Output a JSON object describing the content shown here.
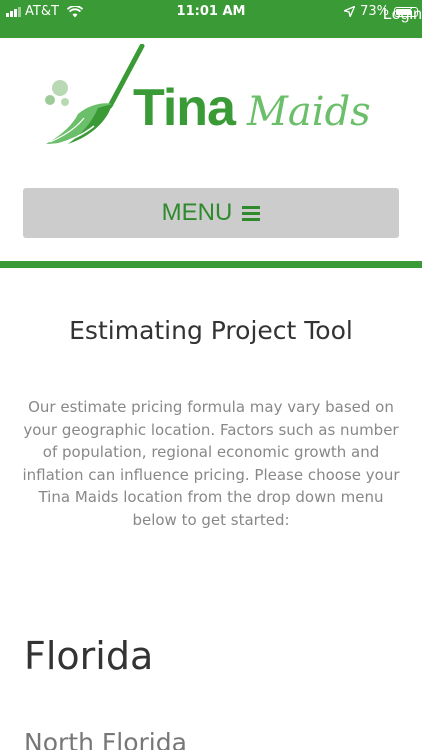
{
  "status_bar": {
    "carrier": "AT&T",
    "time": "11:01 AM",
    "battery": "73%",
    "battery_level": 0.73
  },
  "header": {
    "login_label": "Login"
  },
  "logo": {
    "word1": "Tina",
    "word2": "Maids"
  },
  "nav": {
    "menu_label": "MENU"
  },
  "main": {
    "title": "Estimating Project Tool",
    "intro": "Our estimate pricing formula may vary based on your geographic location. Factors such as number of population, regional economic growth and inflation can influence pricing. Please choose your Tina Maids location from the drop down menu below to get started:",
    "region": "Florida",
    "subregion": "North Florida"
  },
  "colors": {
    "brand_green": "#3a9a36",
    "light_green": "#6cbf6a",
    "menu_bg": "#cccccc"
  },
  "icons": [
    "signal-icon",
    "wifi-icon",
    "location-arrow-icon",
    "battery-icon",
    "broom-logo-icon",
    "hamburger-icon"
  ]
}
